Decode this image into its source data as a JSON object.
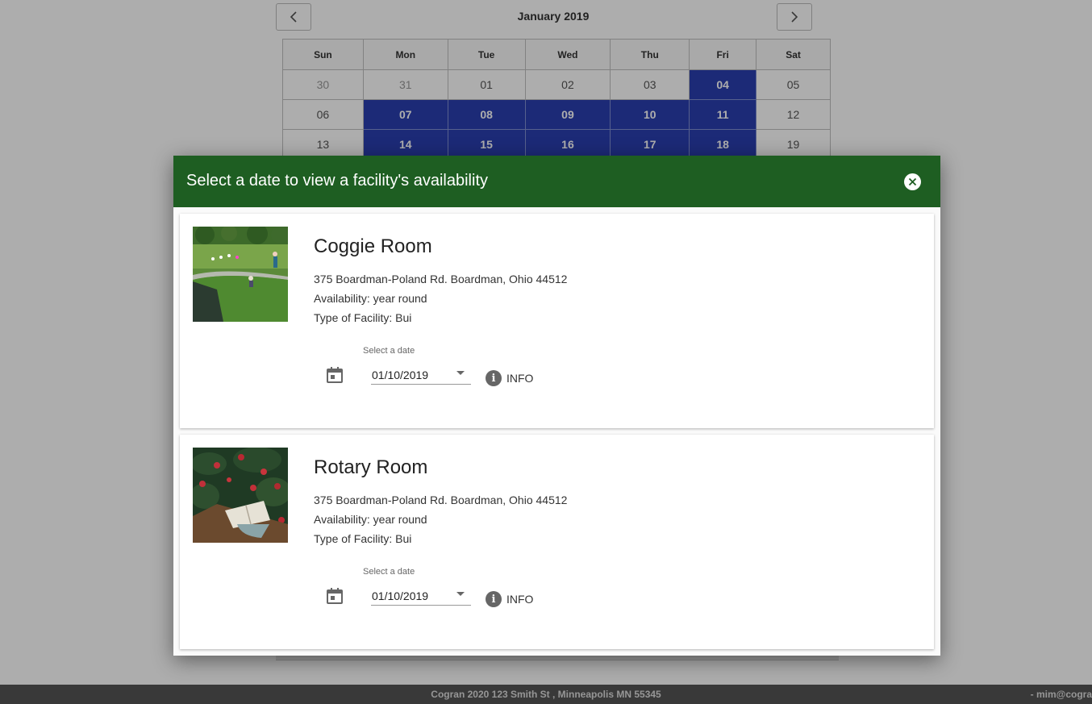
{
  "calendar": {
    "month_title": "January 2019",
    "weekdays": [
      "Sun",
      "Mon",
      "Tue",
      "Wed",
      "Thu",
      "Fri",
      "Sat"
    ],
    "rows": [
      [
        "30",
        "31",
        "01",
        "02",
        "03",
        "04",
        "05"
      ],
      [
        "06",
        "07",
        "08",
        "09",
        "10",
        "11",
        "12"
      ],
      [
        "13",
        "14",
        "15",
        "16",
        "17",
        "18",
        "19"
      ]
    ],
    "selected_days": [
      "04",
      "07",
      "08",
      "09",
      "10",
      "11",
      "14",
      "15",
      "16",
      "17",
      "18"
    ],
    "muted_days": [
      "30",
      "31"
    ]
  },
  "footer": {
    "center_text": "Cogran 2020 123 Smith St , Minneapolis MN 55345",
    "right_text": "- mim@cogra"
  },
  "modal": {
    "title": "Select a date to view a facility's availability",
    "facilities": [
      {
        "name": "Coggie Room",
        "address": "375 Boardman-Poland Rd. Boardman, Ohio 44512",
        "availability": "Availability: year round",
        "type": "Type of Facility: Bui",
        "date_label": "Select a date",
        "date_value": "01/10/2019",
        "info_label": "INFO"
      },
      {
        "name": "Rotary Room",
        "address": "375 Boardman-Poland Rd. Boardman, Ohio 44512",
        "availability": "Availability: year round",
        "type": "Type of Facility: Bui",
        "date_label": "Select a date",
        "date_value": "01/10/2019",
        "info_label": "INFO"
      }
    ]
  },
  "colors": {
    "header_green": "#1e5e22",
    "selected_blue": "#2a3fb0"
  }
}
